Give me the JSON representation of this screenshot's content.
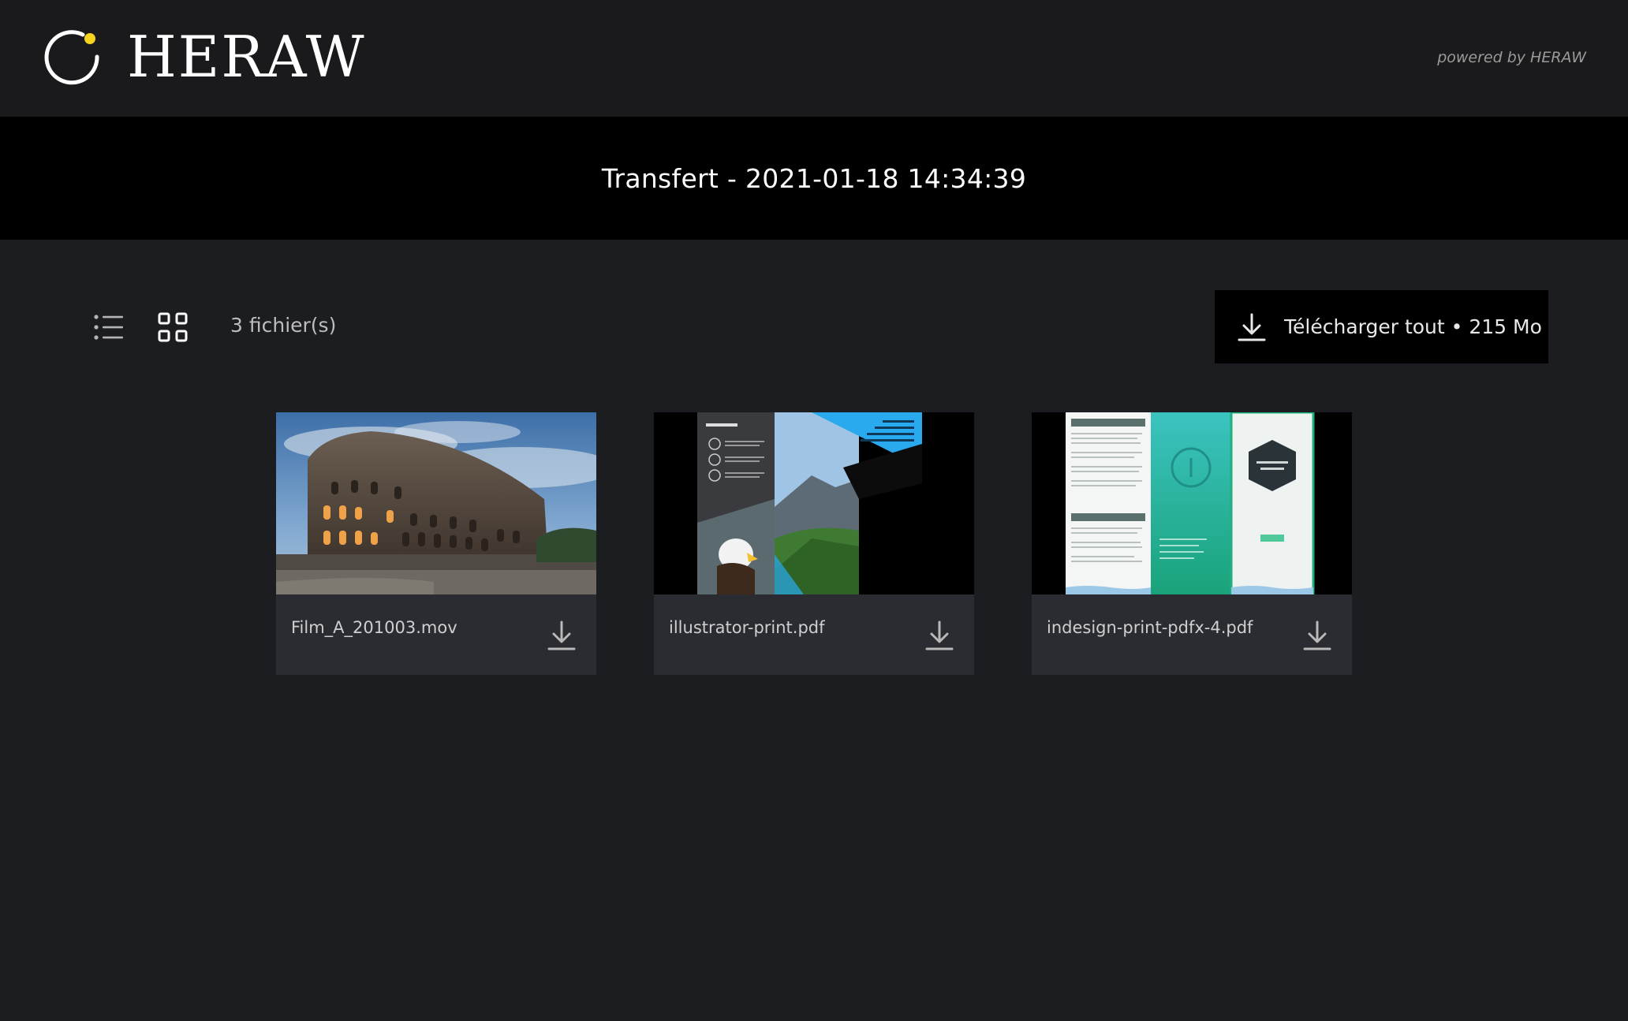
{
  "brand": {
    "logo_text": "HERAW",
    "powered_by": "powered by HERAW",
    "accent_color": "#f5d31f"
  },
  "transfer": {
    "title": "Transfert - 2021-01-18 14:34:39"
  },
  "toolbar": {
    "file_count": "3 fichier(s)",
    "download_all_label": "Télécharger tout • 215 Mo",
    "list_view_icon": "list-icon",
    "grid_view_icon": "grid-icon",
    "active_view": "grid"
  },
  "files": [
    {
      "name": "Film_A_201003.mov",
      "thumbnail": "colosseum-photo",
      "icon": "download-icon"
    },
    {
      "name": "illustrator-print.pdf",
      "thumbnail": "brochure-eagle-mountain",
      "icon": "download-icon"
    },
    {
      "name": "indesign-print-pdfx-4.pdf",
      "thumbnail": "trifold-teal-menu",
      "icon": "download-icon"
    }
  ]
}
